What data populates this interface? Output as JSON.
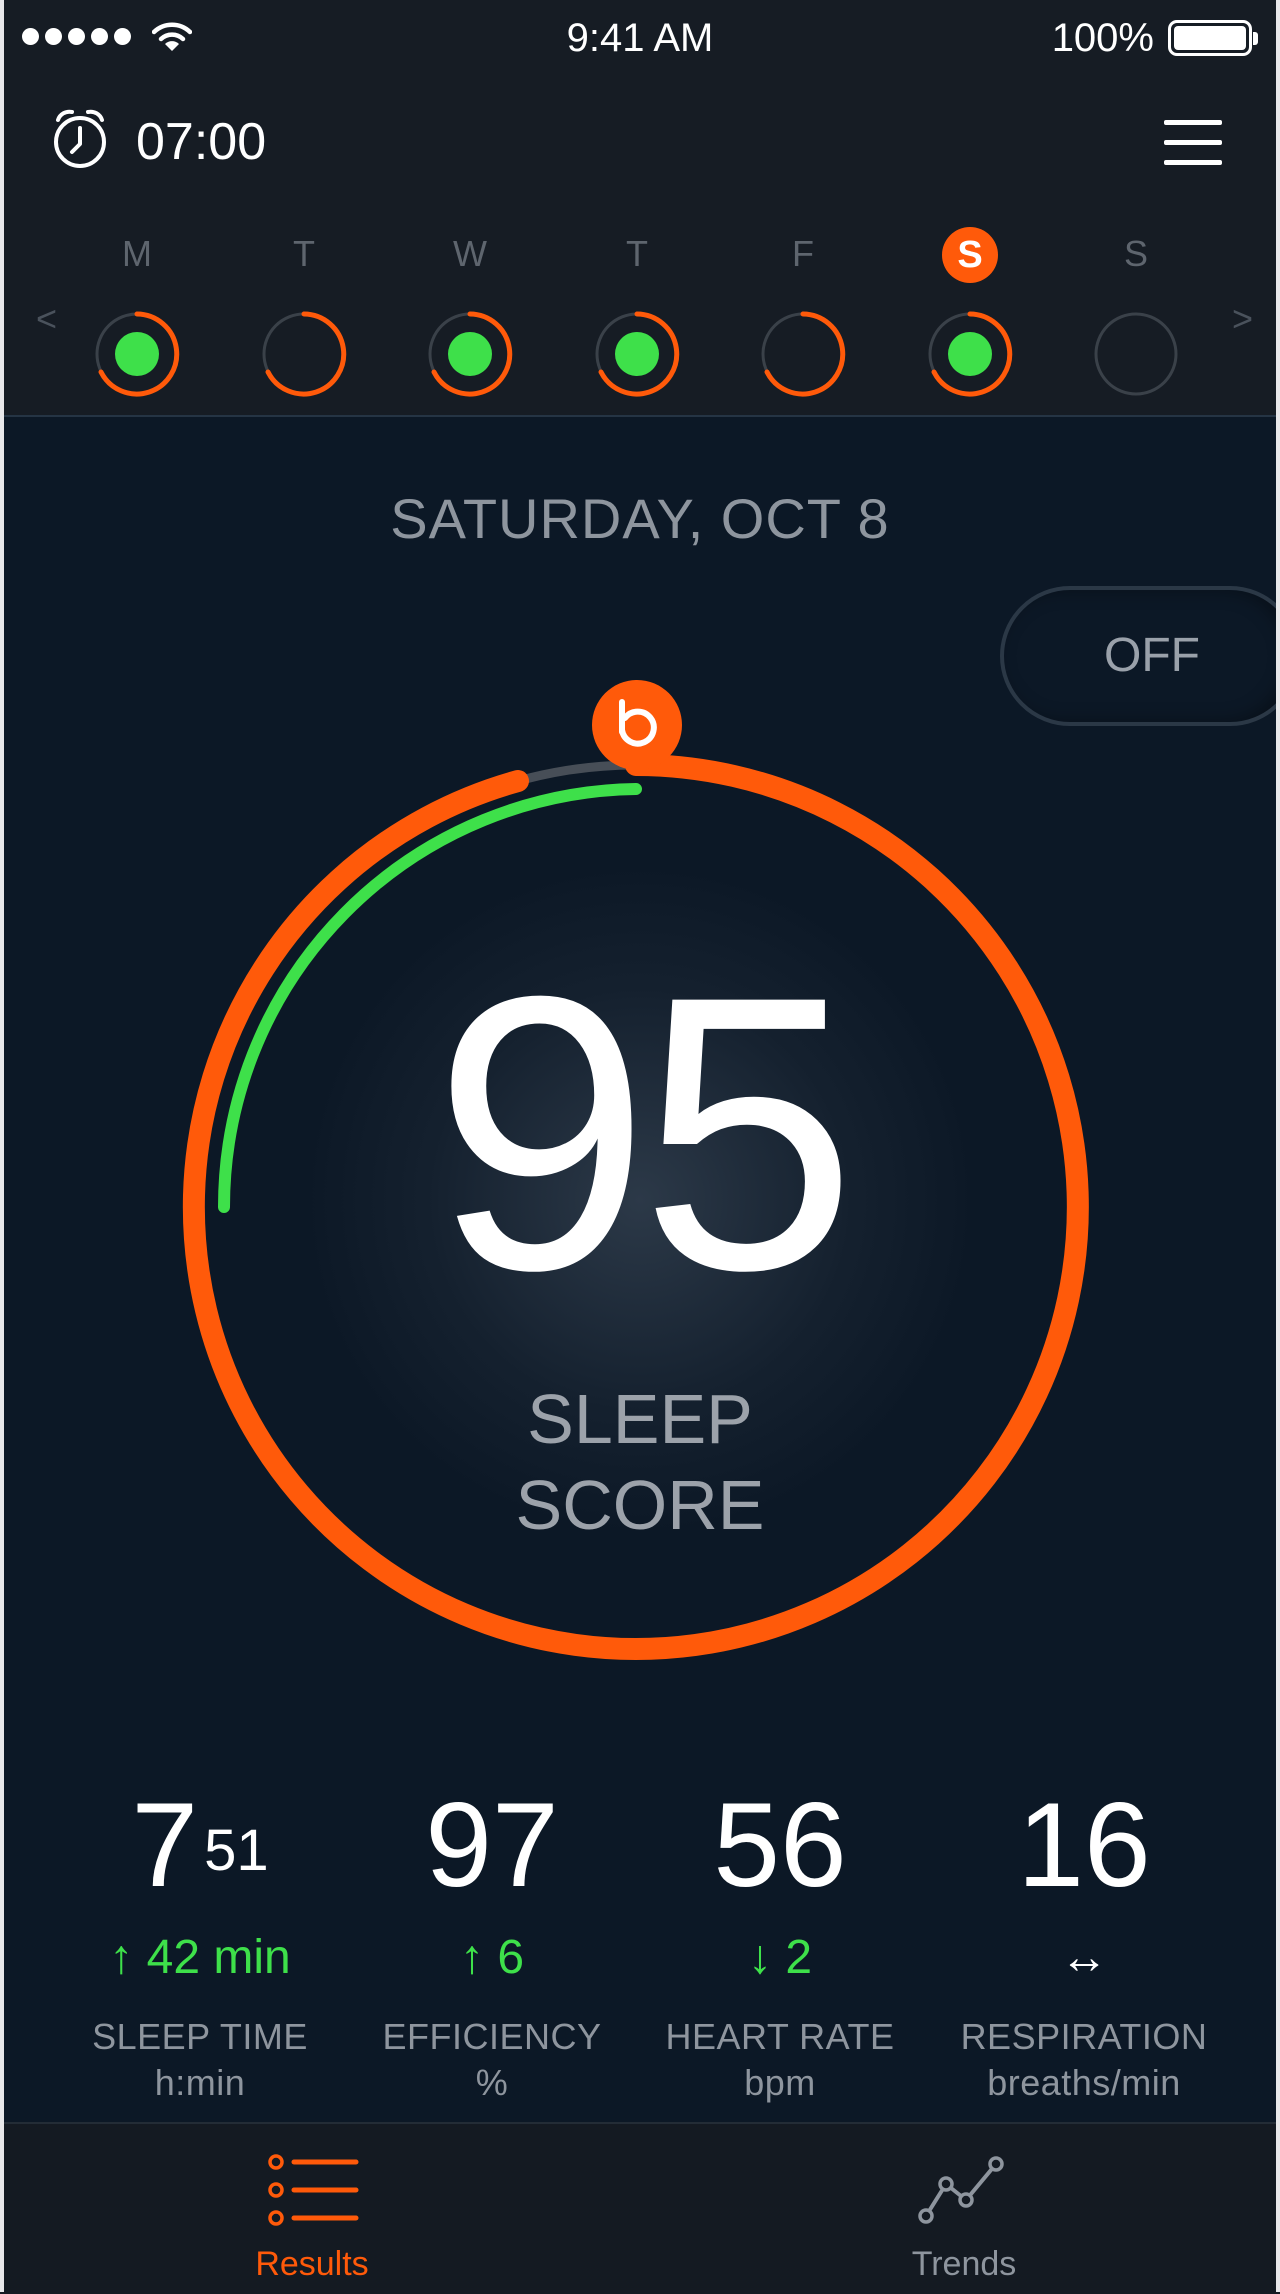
{
  "status_bar": {
    "time": "9:41 AM",
    "battery": "100%"
  },
  "header": {
    "alarm_time": "07:00"
  },
  "week": {
    "days": [
      {
        "letter": "M",
        "has_data": true,
        "active": false
      },
      {
        "letter": "T",
        "has_data": false,
        "active": false
      },
      {
        "letter": "W",
        "has_data": true,
        "active": false
      },
      {
        "letter": "T",
        "has_data": true,
        "active": false
      },
      {
        "letter": "F",
        "has_data": false,
        "active": false
      },
      {
        "letter": "S",
        "has_data": true,
        "active": true
      },
      {
        "letter": "S",
        "has_data": false,
        "active": false
      }
    ],
    "prev": "<",
    "next": ">"
  },
  "date": "SATURDAY, OCT 8",
  "toggle": "OFF",
  "score": {
    "value": "95",
    "label_line1": "SLEEP",
    "label_line2": "SCORE"
  },
  "metrics": [
    {
      "value": "7",
      "value_sup": "51",
      "delta": "42 min",
      "delta_dir": "up",
      "label": "SLEEP TIME",
      "unit": "h:min"
    },
    {
      "value": "97",
      "value_sup": "",
      "delta": "6",
      "delta_dir": "up",
      "label": "EFFICIENCY",
      "unit": "%"
    },
    {
      "value": "56",
      "value_sup": "",
      "delta": "2",
      "delta_dir": "down",
      "label": "HEART RATE",
      "unit": "bpm"
    },
    {
      "value": "16",
      "value_sup": "",
      "delta": "",
      "delta_dir": "neutral",
      "label": "RESPIRATION",
      "unit": "breaths/min"
    }
  ],
  "tabs": [
    {
      "label": "Results",
      "active": true
    },
    {
      "label": "Trends",
      "active": false
    }
  ],
  "colors": {
    "accent": "#ff5a0a",
    "good": "#3ee04a",
    "background": "#0c1826",
    "panel": "#161c24"
  }
}
